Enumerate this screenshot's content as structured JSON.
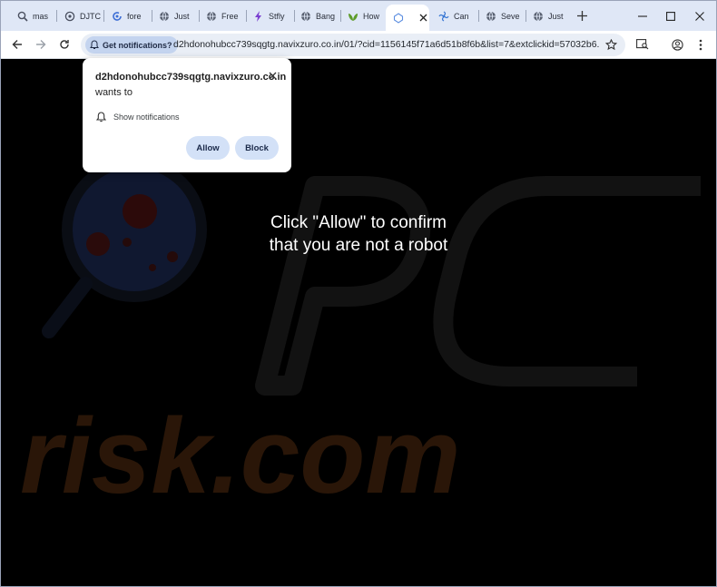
{
  "tabs": [
    {
      "label": "mas",
      "icon": "magnifier-icon"
    },
    {
      "label": "DJTC",
      "icon": "crosshair-icon"
    },
    {
      "label": "fore",
      "icon": "spiral-icon"
    },
    {
      "label": "Just",
      "icon": "globe-icon"
    },
    {
      "label": "Free",
      "icon": "globe-icon"
    },
    {
      "label": "Stfly",
      "icon": "bolt-icon"
    },
    {
      "label": "Bang",
      "icon": "globe-icon"
    },
    {
      "label": "How",
      "icon": "leaf-icon"
    },
    {
      "label": "",
      "icon": "loading-icon",
      "active": true
    },
    {
      "label": "Can",
      "icon": "fan-icon"
    },
    {
      "label": "Seve",
      "icon": "globe-icon"
    },
    {
      "label": "Just",
      "icon": "globe-icon"
    }
  ],
  "toolbar": {
    "permission_chip": "Get notifications?",
    "url": "d2hdonohubcc739sqgtg.navixzuro.co.in/01/?cid=1156145f71a6d51b8f6b&list=7&extclickid=57032b6..."
  },
  "popup": {
    "site_bold": "d2hdonohubcc739sqgtg.navixzuro.co.in",
    "site_suffix": " wants to",
    "permission_label": "Show notifications",
    "allow_label": "Allow",
    "block_label": "Block"
  },
  "page": {
    "line1": "Click \"Allow\" to confirm",
    "line2": "that you are not a robot",
    "watermark_text": "risk.com"
  },
  "colors": {
    "tabstrip": "#dfe7f6",
    "chip": "#c4d4ef",
    "button": "#d3e1f7",
    "watermark_orange": "#3a1d0a"
  }
}
